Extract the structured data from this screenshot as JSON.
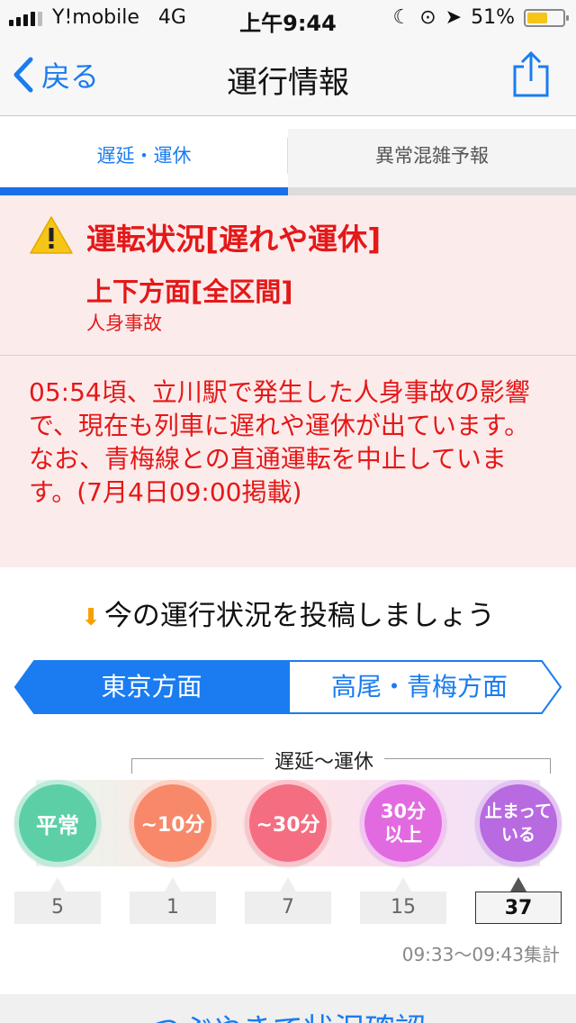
{
  "status_bar": {
    "carrier": "Y!mobile",
    "network": "4G",
    "time": "上午9:44",
    "battery": "51%",
    "battery_level": 0.51
  },
  "nav": {
    "back_label": "戻る",
    "title": "運行情報"
  },
  "tabs": [
    {
      "label": "遅延・運休",
      "active": true
    },
    {
      "label": "異常混雑予報",
      "active": false
    }
  ],
  "alert": {
    "title": "運転状況[遅れや運休]",
    "direction": "上下方面[全区間]",
    "cause": "人身事故",
    "message": "05:54頃、立川駅で発生した人身事故の影響で、現在も列車に遅れや運休が出ています。なお、青梅線との直通運転を中止しています。(7月4日09:00掲載)"
  },
  "post": {
    "title": "今の運行状況を投稿しましょう",
    "directions": [
      {
        "label": "東京方面",
        "active": true
      },
      {
        "label": "高尾・青梅方面",
        "active": false
      }
    ],
    "delay_range_label": "遅延〜運休",
    "options": [
      {
        "line1": "平常",
        "line2": "",
        "count": "5"
      },
      {
        "line1": "~10分",
        "line2": "",
        "count": "1"
      },
      {
        "line1": "~30分",
        "line2": "",
        "count": "7"
      },
      {
        "line1": "30分",
        "line2": "以上",
        "count": "15"
      },
      {
        "line1": "止まって",
        "line2": "いる",
        "count": "37"
      }
    ],
    "tally": "09:33〜09:43集計"
  },
  "bottom": {
    "label": "つぶやきで状況確認"
  },
  "colors": {
    "accent": "#1a7cf0",
    "alert_text": "#e41818",
    "alert_bg": "#fcebeb"
  }
}
